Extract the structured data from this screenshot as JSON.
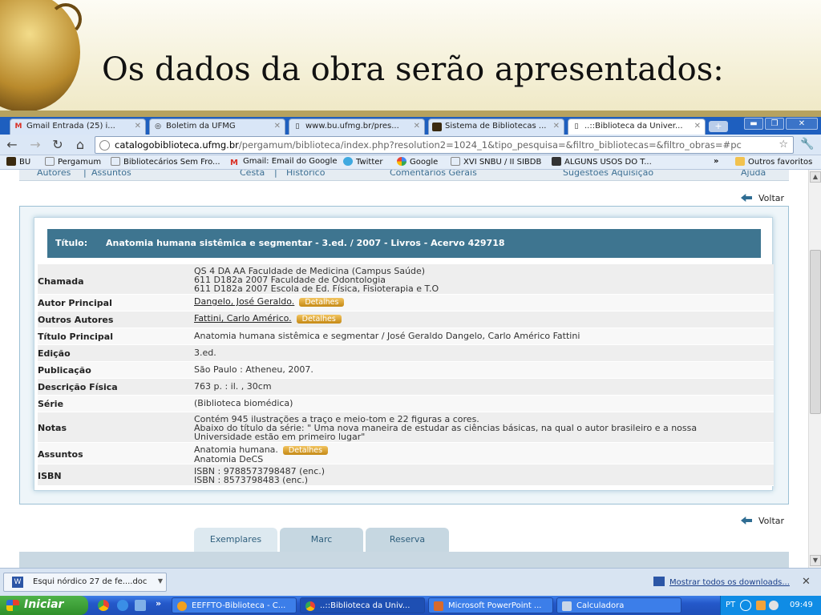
{
  "slide": {
    "title": "Os dados da obra serão apresentados:"
  },
  "browser": {
    "tabs": [
      {
        "label": "Gmail  Entrada (25)  i...",
        "icon": "gmail-icon",
        "active": false
      },
      {
        "label": "Boletim da UFMG",
        "icon": "ufmg-icon",
        "active": false
      },
      {
        "label": "www.bu.ufmg.br/pres...",
        "icon": "page-icon",
        "active": false
      },
      {
        "label": "Sistema de Bibliotecas ...",
        "icon": "bu-icon",
        "active": false
      },
      {
        "label": "..::Biblioteca da Univer...",
        "icon": "page-icon",
        "active": true
      }
    ],
    "url": {
      "host": "catalogobiblioteca.ufmg.br",
      "path": "/pergamum/biblioteca/index.php?resolution2=1024_1&tipo_pesquisa=&filtro_bibliotecas=&filtro_obras=#pc"
    },
    "bookmarks": [
      "BU",
      "Pergamum",
      "Bibliotecários Sem Fro...",
      "Gmail: Email do Google",
      "Twitter",
      "Google",
      "XVI SNBU / II SIBDB",
      "ALGUNS USOS DO T...",
      "Outros favoritos"
    ],
    "bookmarks_more": "»"
  },
  "page": {
    "topnav": {
      "autores": "Autores",
      "sep": "|",
      "assuntos": "Assuntos",
      "cesta": "Cesta",
      "historico": "Histórico",
      "comentarios": "Comentários Gerais",
      "sugestoes": "Sugestões Aquisição",
      "ajuda": "Ajuda"
    },
    "voltar": "Voltar",
    "record": {
      "title_label": "Título:",
      "title_value": "Anatomia humana sistêmica e segmentar - 3.ed. / 2007 - Livros - Acervo 429718",
      "details_label": "Detalhes",
      "rows": {
        "chamada": {
          "label": "Chamada",
          "lines": [
            "QS 4  DA AA  Faculdade de Medicina (Campus Saúde)",
            "611  D182a  2007  Faculdade de Odontologia",
            "611  D182a 2007  Escola de Ed. Física, Fisioterapia e T.O"
          ]
        },
        "autor": {
          "label": "Autor Principal",
          "value": "Dangelo, José Geraldo."
        },
        "outros": {
          "label": "Outros Autores",
          "value": "Fattini, Carlo Américo."
        },
        "titulo": {
          "label": "Título Principal",
          "value": "Anatomia humana sistêmica e segmentar /   José Geraldo Dangelo, Carlo Américo Fattini"
        },
        "edicao": {
          "label": "Edição",
          "value": "3.ed."
        },
        "publicacao": {
          "label": "Publicação",
          "value": "São Paulo :   Atheneu,   2007."
        },
        "descricao": {
          "label": "Descrição Física",
          "value": "763 p. :   il. , 30cm"
        },
        "serie": {
          "label": "Série",
          "value": "(Biblioteca biomédica)"
        },
        "notas": {
          "label": "Notas",
          "lines": [
            "Contém 945 ilustrações a traço e meio-tom e 22 figuras a cores.",
            "Abaixo do título da série: \" Uma nova maneira de estudar as ciências básicas, na qual o autor brasileiro e a nossa",
            "Universidade estão em primeiro lugar\""
          ]
        },
        "assuntos": {
          "label": "Assuntos",
          "lines": [
            "Anatomia humana.",
            "Anatomia DeCS"
          ]
        },
        "isbn": {
          "label": "ISBN",
          "lines": [
            "ISBN : 9788573798487 (enc.)",
            "ISBN : 8573798483 (enc.)"
          ]
        }
      }
    },
    "tabs": [
      "Exemplares",
      "Marc",
      "Reserva"
    ]
  },
  "downloads": {
    "file": "Esqui nórdico  27 de fe....doc",
    "show_all": "Mostrar todos os downloads..."
  },
  "taskbar": {
    "start": "Iniciar",
    "more": "»",
    "tasks": [
      "EEFFTO-Biblioteca - C...",
      "..::Biblioteca da Univ...",
      "Microsoft PowerPoint ...",
      "Calculadora"
    ],
    "lang": "PT",
    "clock": "09:49"
  },
  "colors": {
    "accent": "#3e7590",
    "detalhes": "#e0a532",
    "taskbar": "#2458c9"
  }
}
